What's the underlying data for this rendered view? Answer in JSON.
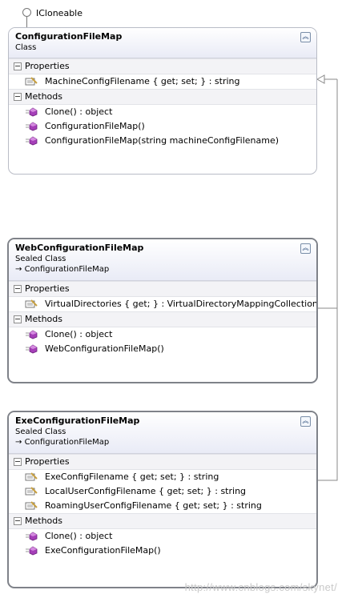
{
  "interface": {
    "name": "ICloneable"
  },
  "classes": [
    {
      "name": "ConfigurationFileMap",
      "kind": "Class",
      "base": "",
      "properties_label": "Properties",
      "methods_label": "Methods",
      "properties": [
        "MachineConfigFilename { get; set; } : string"
      ],
      "methods": [
        "Clone() : object",
        "ConfigurationFileMap()",
        "ConfigurationFileMap(string machineConfigFilename)"
      ]
    },
    {
      "name": "WebConfigurationFileMap",
      "kind": "Sealed Class",
      "base": "ConfigurationFileMap",
      "properties_label": "Properties",
      "methods_label": "Methods",
      "properties": [
        "VirtualDirectories { get; } : VirtualDirectoryMappingCollection"
      ],
      "methods": [
        "Clone() : object",
        "WebConfigurationFileMap()"
      ]
    },
    {
      "name": "ExeConfigurationFileMap",
      "kind": "Sealed Class",
      "base": "ConfigurationFileMap",
      "properties_label": "Properties",
      "methods_label": "Methods",
      "properties": [
        "ExeConfigFilename { get; set; } : string",
        "LocalUserConfigFilename { get; set; } : string",
        "RoamingUserConfigFilename { get; set; } : string"
      ],
      "methods": [
        "Clone() : object",
        "ExeConfigurationFileMap()"
      ]
    }
  ],
  "watermark": "http://www.cnblogs.com/skynet/",
  "colors": {
    "box_border": "#b9bcc6",
    "header_gradient_end": "#e9ebf6",
    "line": "#8a8a8a",
    "property_icon": "#c8a040",
    "method_icon": "#a53fb8"
  },
  "icons": {
    "interface": "lollipop-interface-icon",
    "collapse": "chevron-up-double-icon",
    "section_toggle": "minus-toggle-icon",
    "property": "property-wrench-icon",
    "method": "method-cube-icon"
  }
}
